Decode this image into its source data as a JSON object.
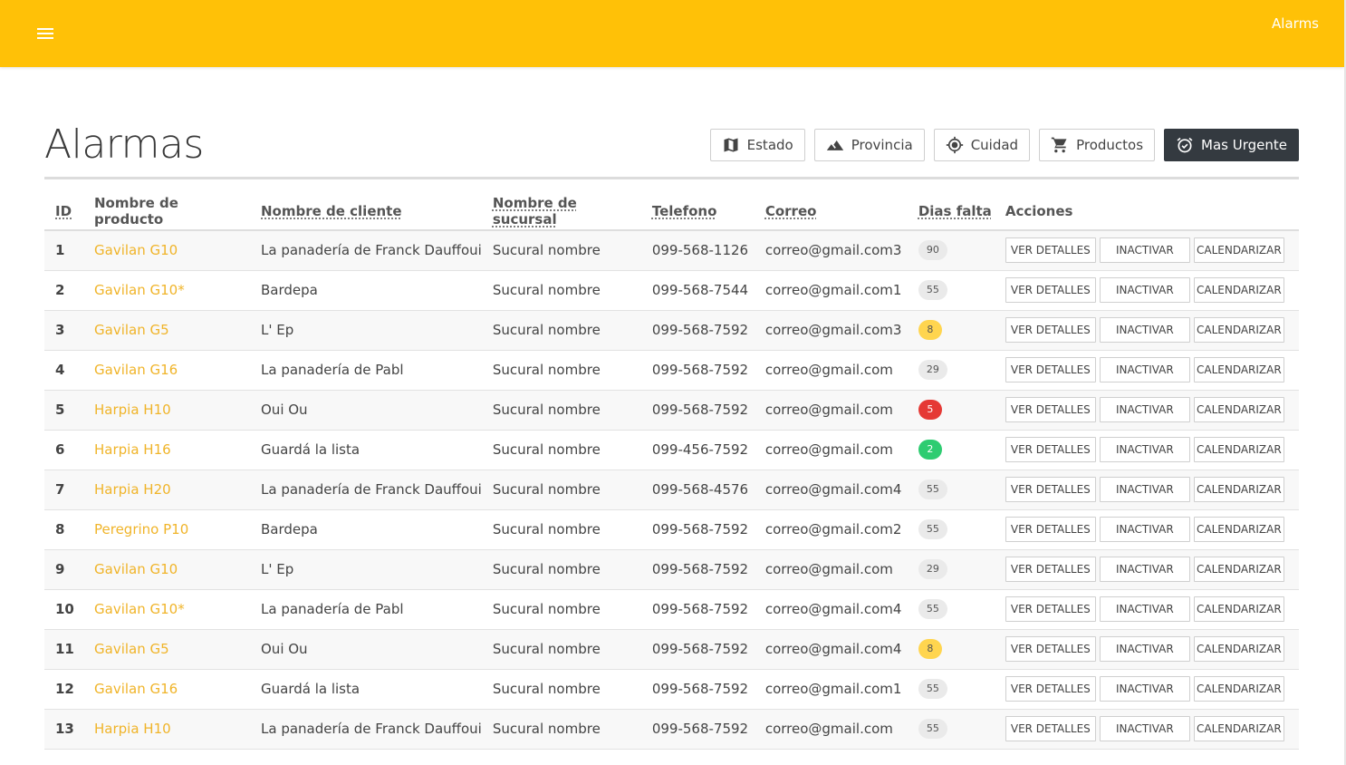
{
  "appbar": {
    "title": "Alarms"
  },
  "page": {
    "title": "Alarmas"
  },
  "filters": [
    {
      "label": "Estado",
      "icon": "map-icon"
    },
    {
      "label": "Provincia",
      "icon": "terrain-icon"
    },
    {
      "label": "Cuidad",
      "icon": "location-target-icon"
    },
    {
      "label": "Productos",
      "icon": "cart-icon"
    },
    {
      "label": "Mas Urgente",
      "icon": "alarm-icon",
      "active": true
    }
  ],
  "table": {
    "headers": [
      "ID",
      "Nombre de producto",
      "Nombre de cliente",
      "Nombre de sucursal",
      "Telefono",
      "Correo",
      "Dias falta",
      "Acciones"
    ],
    "action_labels": [
      "VER DETALLES",
      "INACTIVAR",
      "CALENDARIZAR"
    ],
    "rows": [
      {
        "id": "1",
        "product": "Gavilan G10",
        "client": "La panadería de Franck Dauffoui",
        "branch": "Sucural nombre",
        "phone": "099-568-1126",
        "email": "correo@gmail.com3",
        "days": "90",
        "level": "normal"
      },
      {
        "id": "2",
        "product": "Gavilan G10*",
        "client": "Bardepa",
        "branch": "Sucural nombre",
        "phone": "099-568-7544",
        "email": "correo@gmail.com1",
        "days": "55",
        "level": "normal"
      },
      {
        "id": "3",
        "product": "Gavilan G5",
        "client": "L' Ep",
        "branch": "Sucural nombre",
        "phone": "099-568-7592",
        "email": "correo@gmail.com3",
        "days": "8",
        "level": "warn"
      },
      {
        "id": "4",
        "product": "Gavilan G16",
        "client": "La panadería de Pabl",
        "branch": "Sucural nombre",
        "phone": "099-568-7592",
        "email": "correo@gmail.com",
        "days": "29",
        "level": "normal"
      },
      {
        "id": "5",
        "product": "Harpia H10",
        "client": "Oui Ou",
        "branch": "Sucural nombre",
        "phone": "099-568-7592",
        "email": "correo@gmail.com",
        "days": "5",
        "level": "danger"
      },
      {
        "id": "6",
        "product": "Harpia H16",
        "client": "Guardá la lista",
        "branch": "Sucural nombre",
        "phone": "099-456-7592",
        "email": "correo@gmail.com",
        "days": "2",
        "level": "success"
      },
      {
        "id": "7",
        "product": "Harpia H20",
        "client": "La panadería de Franck Dauffoui",
        "branch": "Sucural nombre",
        "phone": "099-568-4576",
        "email": "correo@gmail.com4",
        "days": "55",
        "level": "normal"
      },
      {
        "id": "8",
        "product": "Peregrino P10",
        "client": "Bardepa",
        "branch": "Sucural nombre",
        "phone": "099-568-7592",
        "email": "correo@gmail.com2",
        "days": "55",
        "level": "normal"
      },
      {
        "id": "9",
        "product": "Gavilan G10",
        "client": "L' Ep",
        "branch": "Sucural nombre",
        "phone": "099-568-7592",
        "email": "correo@gmail.com",
        "days": "29",
        "level": "normal"
      },
      {
        "id": "10",
        "product": "Gavilan G10*",
        "client": "La panadería de Pabl",
        "branch": "Sucural nombre",
        "phone": "099-568-7592",
        "email": "correo@gmail.com4",
        "days": "55",
        "level": "normal"
      },
      {
        "id": "11",
        "product": "Gavilan G5",
        "client": "Oui Ou",
        "branch": "Sucural nombre",
        "phone": "099-568-7592",
        "email": "correo@gmail.com4",
        "days": "8",
        "level": "warn"
      },
      {
        "id": "12",
        "product": "Gavilan G16",
        "client": "Guardá la lista",
        "branch": "Sucural nombre",
        "phone": "099-568-7592",
        "email": "correo@gmail.com1",
        "days": "55",
        "level": "normal"
      },
      {
        "id": "13",
        "product": "Harpia H10",
        "client": "La panadería de Franck Dauffoui",
        "branch": "Sucural nombre",
        "phone": "099-568-7592",
        "email": "correo@gmail.com",
        "days": "55",
        "level": "normal"
      }
    ]
  },
  "colors": {
    "appbar": "#ffc107",
    "link": "#f0b429",
    "danger": "#e53935",
    "success": "#2ecc71",
    "warn": "#ffd54f",
    "dark_button": "#343a40"
  }
}
